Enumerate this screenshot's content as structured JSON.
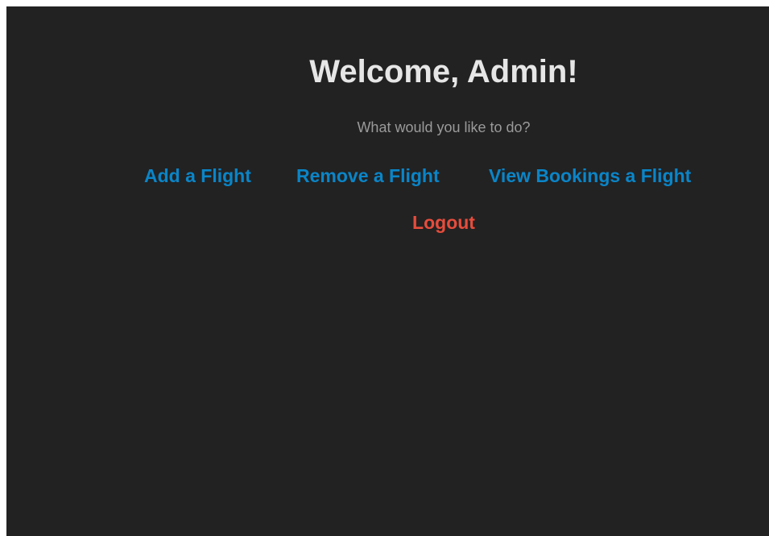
{
  "header": {
    "title": "Welcome, Admin!",
    "subtitle": "What would you like to do?"
  },
  "nav": {
    "items": [
      {
        "label": "Add a Flight"
      },
      {
        "label": "Remove a Flight"
      },
      {
        "label": "View Bookings a Flight"
      }
    ],
    "logout_label": "Logout"
  },
  "colors": {
    "background": "#222222",
    "title": "#e6e6e6",
    "subtitle": "#9a9a9a",
    "link": "#0a85c8",
    "logout": "#e74c3c"
  }
}
